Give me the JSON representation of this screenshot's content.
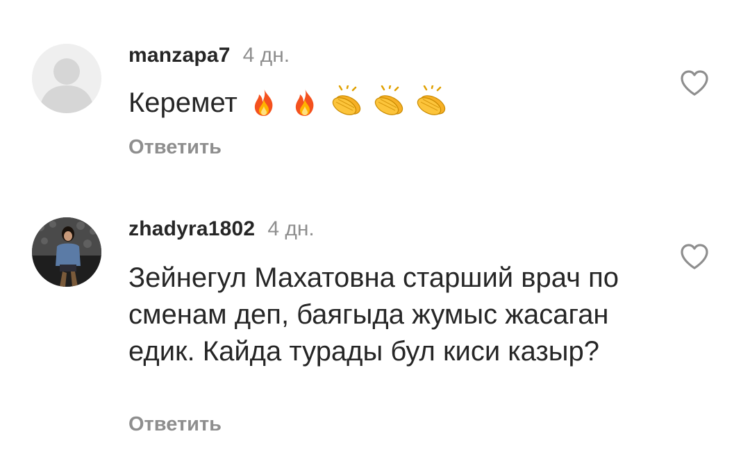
{
  "comments": [
    {
      "username": "manzapa7",
      "time": "4 дн.",
      "text": "Керемет",
      "emojis": [
        "fire",
        "fire",
        "clap",
        "clap",
        "clap"
      ],
      "reply_label": "Ответить",
      "avatar": "default-avatar"
    },
    {
      "username": "zhadyra1802",
      "time": "4 дн.",
      "text": "Зейнегул Махатовна старший врач по сменам деп,  баягыда жумыс жасаган едик. Кайда турады бул киси казыр?",
      "reply_label": "Ответить",
      "avatar": "photo-avatar"
    }
  ],
  "colors": {
    "text": "#262626",
    "secondary": "#8e8e8e",
    "avatar_placeholder": "#dbdbdb"
  }
}
